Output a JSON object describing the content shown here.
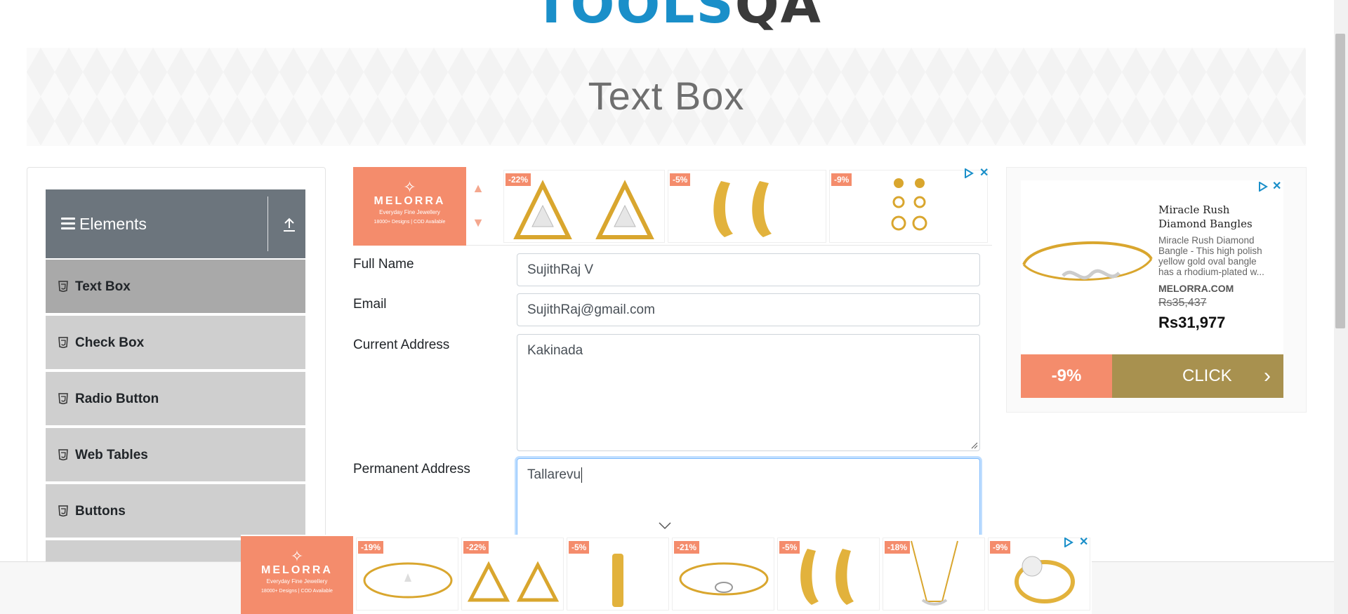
{
  "logo": {
    "part1": "TOOLS",
    "part2": "QA"
  },
  "banner": {
    "title": "Text Box"
  },
  "sidebar": {
    "group_title": "Elements",
    "items": [
      {
        "label": "Text Box",
        "active": true
      },
      {
        "label": "Check Box"
      },
      {
        "label": "Radio Button"
      },
      {
        "label": "Web Tables"
      },
      {
        "label": "Buttons"
      }
    ]
  },
  "top_ad": {
    "brand": "MELORRA",
    "tagline": "Everyday Fine Jewellery",
    "stat1": "18000+ Designs",
    "stat2": "COD Available",
    "tiles": [
      {
        "badge": "-22%"
      },
      {
        "badge": "-5%"
      },
      {
        "badge": "-9%"
      }
    ]
  },
  "form": {
    "full_name": {
      "label": "Full Name",
      "value": "SujithRaj V"
    },
    "email": {
      "label": "Email",
      "value": "SujithRaj@gmail.com"
    },
    "current_address": {
      "label": "Current Address",
      "value": "Kakinada"
    },
    "permanent_address": {
      "label": "Permanent Address",
      "value": "Tallarevu"
    }
  },
  "side_ad": {
    "title": "Miracle Rush Diamond Bangles",
    "description": "Miracle Rush Diamond Bangle - This high polish yellow gold oval bangle has a rhodium-plated w...",
    "domain": "MELORRA.COM",
    "old_price": "Rs35,437",
    "price": "Rs31,977",
    "discount": "-9%",
    "cta": "CLICK"
  },
  "bottom_ad": {
    "brand": "MELORRA",
    "tagline": "Everyday Fine Jewellery",
    "stat1": "18000+ Designs",
    "stat2": "COD Available",
    "tiles": [
      {
        "badge": "-19%"
      },
      {
        "badge": "-22%"
      },
      {
        "badge": "-5%"
      },
      {
        "badge": "-21%"
      },
      {
        "badge": "-5%"
      },
      {
        "badge": "-18%"
      },
      {
        "badge": "-9%"
      }
    ]
  },
  "colors": {
    "accent": "#1a8fc9",
    "ad_coral": "#f48c6c",
    "ad_gold": "#a8914f",
    "sidebar_header": "#6c757d",
    "menu_active": "#a9a9a9",
    "menu_item": "#cfcfcf"
  }
}
